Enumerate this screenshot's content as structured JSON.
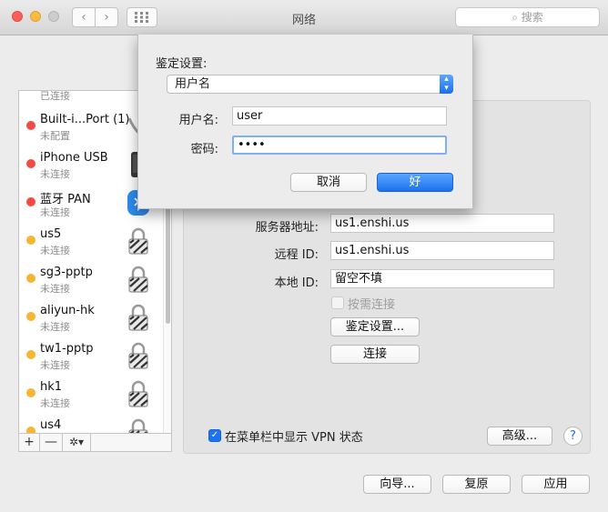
{
  "window": {
    "title": "网络",
    "search_placeholder": "搜索"
  },
  "colors": {
    "red": "#f14c42",
    "yellow": "#f8b532",
    "accent": "#1d72f2"
  },
  "sidebar": {
    "items": [
      {
        "name": "",
        "status": "已连接",
        "dot": "green"
      },
      {
        "name": "Built-i...Port (1)",
        "status": "未配置",
        "dot": "red",
        "icon": "phone-icon"
      },
      {
        "name": "iPhone USB",
        "status": "未连接",
        "dot": "red",
        "icon": "iphone-icon"
      },
      {
        "name": "蓝牙 PAN",
        "status": "未连接",
        "dot": "red",
        "icon": "bluetooth-icon"
      },
      {
        "name": "us5",
        "status": "未连接",
        "dot": "yellow",
        "icon": "vpn-lock-icon"
      },
      {
        "name": "sg3-pptp",
        "status": "未连接",
        "dot": "yellow",
        "icon": "vpn-lock-icon"
      },
      {
        "name": "aliyun-hk",
        "status": "未连接",
        "dot": "yellow",
        "icon": "vpn-lock-icon"
      },
      {
        "name": "tw1-pptp",
        "status": "未连接",
        "dot": "yellow",
        "icon": "vpn-lock-icon"
      },
      {
        "name": "hk1",
        "status": "未连接",
        "dot": "yellow",
        "icon": "vpn-lock-icon"
      },
      {
        "name": "us4",
        "status": "",
        "dot": "yellow",
        "icon": "vpn-lock-icon"
      }
    ],
    "toolbar": {
      "add": "+",
      "remove": "—",
      "action": "✲▾"
    }
  },
  "panel": {
    "server_label": "服务器地址:",
    "server_value": "us1.enshi.us",
    "remote_label": "远程 ID:",
    "remote_value": "us1.enshi.us",
    "local_label": "本地 ID:",
    "local_value": "留空不填",
    "on_demand_label": "按需连接",
    "auth_button": "鉴定设置...",
    "connect_button": "连接",
    "show_vpn_label": "在菜单栏中显示 VPN 状态",
    "advanced_button": "高级...",
    "help": "?"
  },
  "footer": {
    "assist": "向导...",
    "revert": "复原",
    "apply": "应用"
  },
  "sheet": {
    "heading": "鉴定设置:",
    "auth_type": "用户名",
    "username_label": "用户名:",
    "username_value": "user",
    "password_label": "密码:",
    "password_value": "••••",
    "cancel": "取消",
    "ok": "好"
  }
}
